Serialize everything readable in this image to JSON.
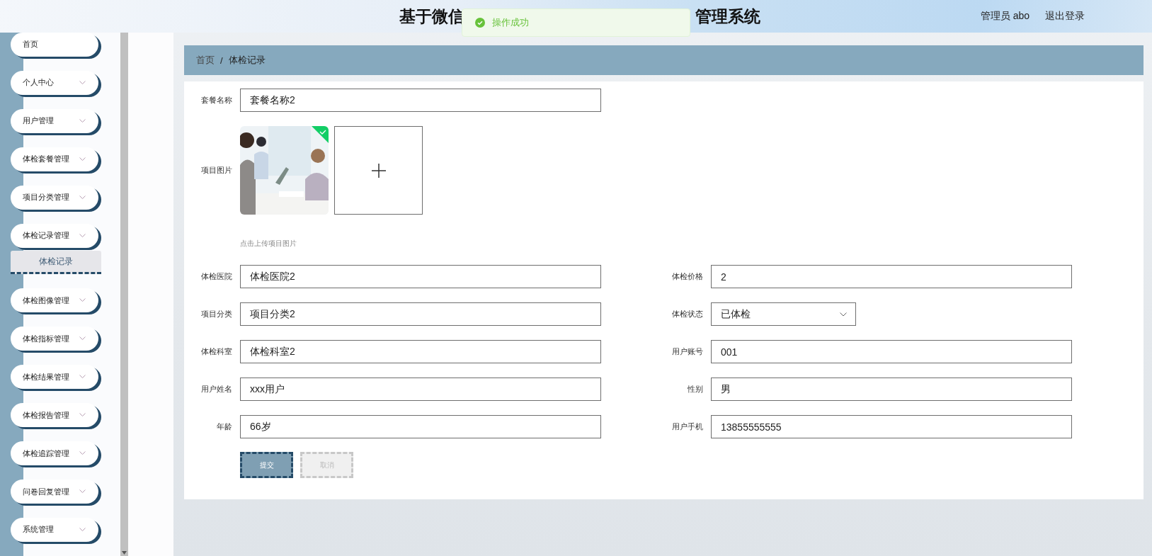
{
  "header": {
    "title_parts": [
      "基于微信",
      "管理系统"
    ],
    "user": "管理员 abo",
    "logout": "退出登录"
  },
  "toast": {
    "message": "操作成功"
  },
  "sidebar": {
    "items": [
      {
        "label": "首页",
        "kind": "link"
      },
      {
        "label": "个人中心",
        "kind": "submenu"
      },
      {
        "label": "用户管理",
        "kind": "submenu"
      },
      {
        "label": "体检套餐管理",
        "kind": "submenu"
      },
      {
        "label": "项目分类管理",
        "kind": "submenu"
      },
      {
        "label": "体检记录管理",
        "kind": "submenu",
        "children": [
          {
            "label": "体检记录",
            "selected": true
          }
        ]
      },
      {
        "label": "体检图像管理",
        "kind": "submenu"
      },
      {
        "label": "体检指标管理",
        "kind": "submenu"
      },
      {
        "label": "体检结果管理",
        "kind": "submenu"
      },
      {
        "label": "体检报告管理",
        "kind": "submenu"
      },
      {
        "label": "体检追踪管理",
        "kind": "submenu"
      },
      {
        "label": "问卷回复管理",
        "kind": "submenu"
      },
      {
        "label": "系统管理",
        "kind": "submenu"
      }
    ]
  },
  "breadcrumb": {
    "separator": "/",
    "items": [
      "首页",
      "体检记录"
    ]
  },
  "form": {
    "name_field": {
      "label": "套餐名称",
      "value": "套餐名称2"
    },
    "image_field": {
      "label": "项目图片",
      "files": [
        {
          "kind": "picture",
          "uploaded": true
        }
      ],
      "hint": "点击上传项目图片"
    },
    "fields": [
      {
        "label": "体检医院",
        "value": "体检医院2",
        "kind": "text"
      },
      {
        "label": "体检价格",
        "value": "2",
        "kind": "text"
      },
      {
        "label": "项目分类",
        "value": "项目分类2",
        "kind": "text"
      },
      {
        "label": "体检状态",
        "value": "已体检",
        "kind": "select"
      },
      {
        "label": "体检科室",
        "value": "体检科室2",
        "kind": "text"
      },
      {
        "label": "用户账号",
        "value": "001",
        "kind": "text"
      },
      {
        "label": "用户姓名",
        "value": "xxx用户",
        "kind": "text"
      },
      {
        "label": "性别",
        "value": "男",
        "kind": "text"
      },
      {
        "label": "年龄",
        "value": "66岁",
        "kind": "text"
      },
      {
        "label": "用户手机",
        "value": "13855555555",
        "kind": "text"
      }
    ],
    "buttons": [
      {
        "label": "提交",
        "kind": "primary"
      },
      {
        "label": "取消",
        "kind": "secondary"
      }
    ]
  }
}
